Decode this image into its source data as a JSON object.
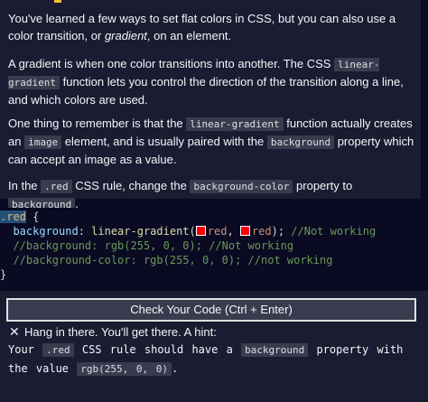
{
  "lesson": {
    "p1": {
      "a": "You've learned a few ways to set flat colors in CSS, but you can also use a color transition, or ",
      "em": "gradient",
      "b": ", on an element."
    },
    "p2": {
      "a": "A gradient is when one color transitions into another. The CSS ",
      "code": "linear-gradient",
      "b": " function lets you control the direction of the transition along a line, and which colors are used."
    },
    "p3": {
      "a": "One thing to remember is that the ",
      "code1": "linear-gradient",
      "b": " function actually creates an ",
      "code2": "image",
      "c": " element, and is usually paired with the ",
      "code3": "background",
      "d": " property which can accept an image as a value."
    },
    "p4": {
      "a": "In the ",
      "code1": ".red",
      "b": " CSS rule, change the ",
      "code2": "background-color",
      "c": " property to ",
      "code3": "background",
      "d": "."
    }
  },
  "editor": {
    "line1": {
      "selector": ".red",
      "brace": " {"
    },
    "line2": {
      "prop": "background",
      "colon": ": ",
      "fn": "linear-gradient",
      "paren": "(",
      "val1": "red",
      "comma": ", ",
      "val2": "red",
      "end": "); ",
      "comment": "//Not working"
    },
    "line3": {
      "comment": "//background: rgb(255, 0, 0); //Not working"
    },
    "line4": {
      "comment": "//background-color: rgb(255, 0, 0); //not working"
    },
    "line5": {
      "brace": "}"
    },
    "swatch_color": "#ff0000"
  },
  "check_button": {
    "label": "Check Your Code (Ctrl + Enter)"
  },
  "hint": {
    "icon": "x-icon",
    "title": "Hang in there. You'll get there. A hint:",
    "a": "Your ",
    "code1": ".red",
    "b": " CSS rule should have a ",
    "code2": "background",
    "c": " property with the value ",
    "code3": "rgb(255, 0, 0)",
    "d": "."
  }
}
